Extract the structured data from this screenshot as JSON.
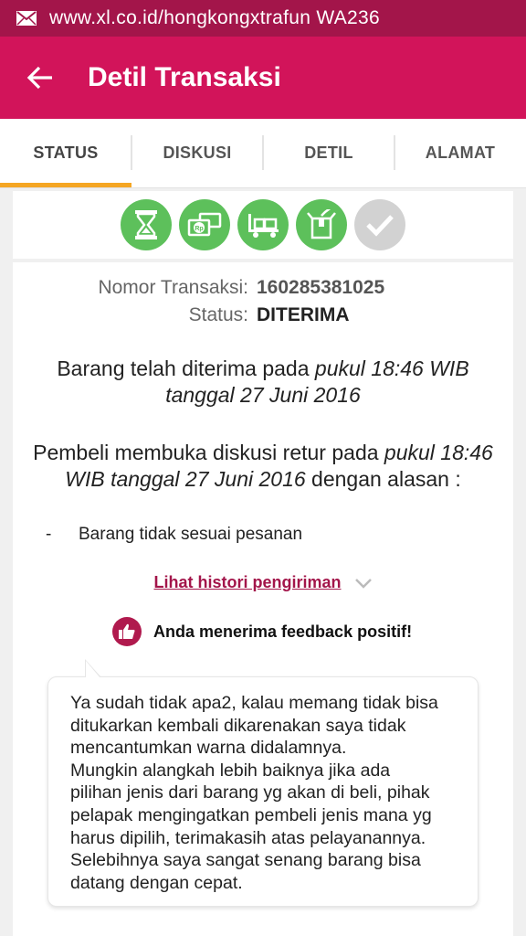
{
  "status_bar": {
    "icon": "mail-icon",
    "text": "www.xl.co.id/hongkongxtrafun WA236"
  },
  "app_bar": {
    "back_icon": "arrow-left-icon",
    "title": "Detil Transaksi"
  },
  "tabs": [
    {
      "label": "STATUS",
      "active": true
    },
    {
      "label": "DISKUSI",
      "active": false
    },
    {
      "label": "DETIL",
      "active": false
    },
    {
      "label": "ALAMAT",
      "active": false
    }
  ],
  "steps": [
    {
      "icon": "hourglass-icon",
      "state": "done"
    },
    {
      "icon": "payment-icon",
      "state": "done"
    },
    {
      "icon": "shipping-truck-icon",
      "state": "done"
    },
    {
      "icon": "package-received-icon",
      "state": "done"
    },
    {
      "icon": "checkmark-icon",
      "state": "pending"
    }
  ],
  "transaction": {
    "number_label": "Nomor Transaksi:",
    "number_value": "160285381025",
    "status_label": "Status:",
    "status_value": "DITERIMA"
  },
  "received": {
    "text": "Barang telah diterima pada ",
    "time": "pukul 18:46 WIB",
    "date": "tanggal 27 Juni 2016"
  },
  "retur": {
    "text": "Pembeli membuka diskusi retur pada ",
    "time_a": "pukul 18:46",
    "time_b": "WIB tanggal 27 Juni 2016",
    "suffix": " dengan alasan :"
  },
  "reason": {
    "bullet": "-",
    "text": "Barang tidak sesuai pesanan"
  },
  "history_link": "Lihat histori pengiriman",
  "feedback": {
    "icon": "thumbs-up-icon",
    "text": "Anda menerima feedback positif!"
  },
  "comment": "Ya sudah tidak apa2, kalau memang tidak bisa\nditukarkan kembali dikarenakan saya tidak\nmencantumkan warna didalamnya.\nMungkin alangkah lebih baiknya jika ada\npilihan jenis dari barang yg akan di beli, pihak\npelapak mengingatkan pembeli jenis mana yg\nharus dipilih, terimakasih atas pelayanannya.\nSelebihnya saya sangat senang barang bisa\ndatang dengan cepat.",
  "colors": {
    "status_bar": "#a3154a",
    "app_bar": "#d2145a",
    "tab_indicator": "#f5a623",
    "step_done": "#5dc05b",
    "step_pending": "#d2d2d2",
    "link": "#a3154a"
  }
}
